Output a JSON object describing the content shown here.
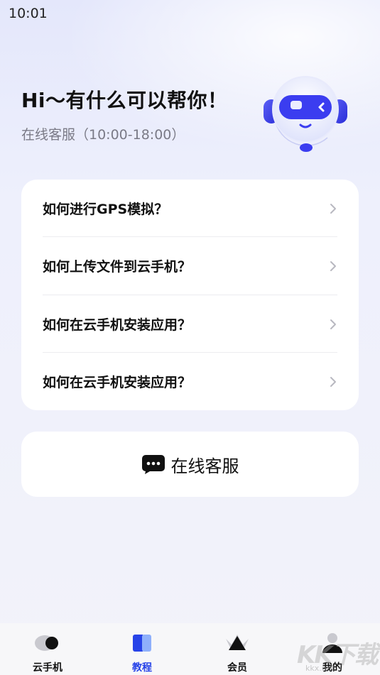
{
  "status_bar": {
    "time": "10:01"
  },
  "hero": {
    "title": "Hi～有什么可以帮你！",
    "subtitle": "在线客服（10:00-18:00）"
  },
  "faq": {
    "items": [
      {
        "label": "如何进行GPS模拟？"
      },
      {
        "label": "如何上传文件到云手机？"
      },
      {
        "label": "如何在云手机安装应用？"
      },
      {
        "label": "如何在云手机安装应用？"
      }
    ]
  },
  "service": {
    "label": "在线客服",
    "icon": "chat-bubble-icon"
  },
  "tabbar": {
    "active_index": 1,
    "tabs": [
      {
        "label": "云手机",
        "icon": "cloud-phone-icon"
      },
      {
        "label": "教程",
        "icon": "book-icon"
      },
      {
        "label": "会员",
        "icon": "crown-icon"
      },
      {
        "label": "我的",
        "icon": "person-icon"
      }
    ]
  },
  "watermark": {
    "text": "KK下载",
    "url": "kkx.net"
  },
  "colors": {
    "accent": "#2743e8",
    "robot_blue": "#3b3df0",
    "text_primary": "#111111",
    "text_secondary": "#7a7a86"
  }
}
